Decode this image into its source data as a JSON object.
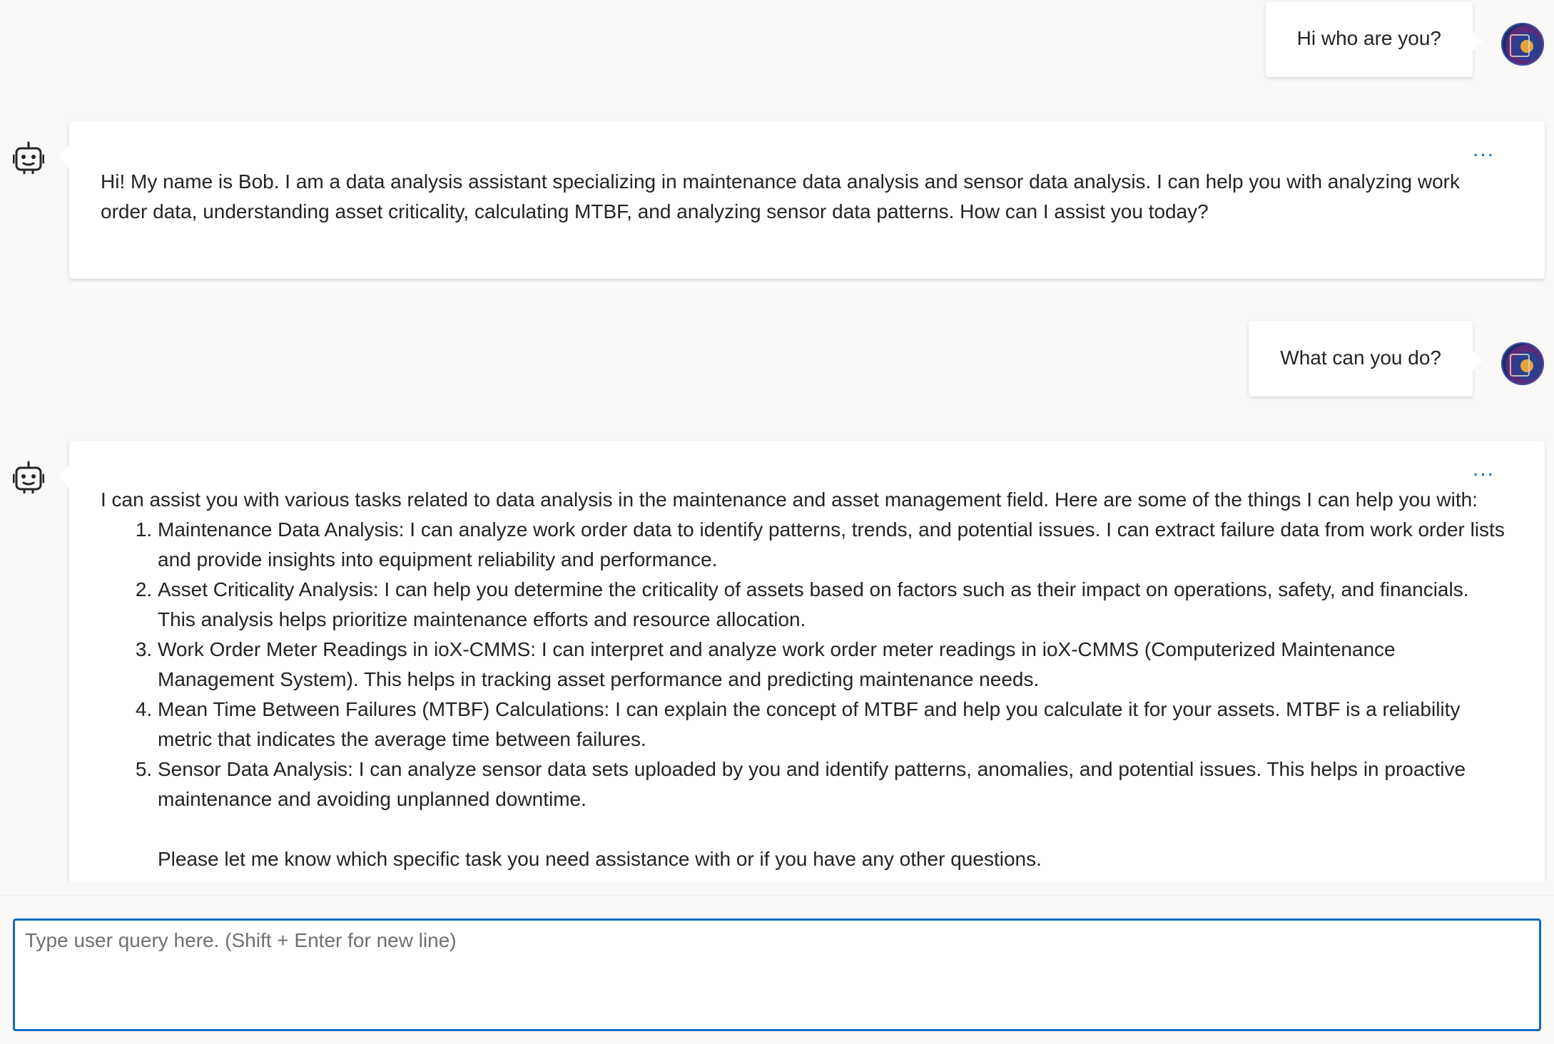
{
  "messages": {
    "user1": {
      "text": "Hi who are you?"
    },
    "bot1": {
      "more_label": "...",
      "text": "Hi! My name is Bob. I am a data analysis assistant specializing in maintenance data analysis and sensor data analysis. I can help you with analyzing work order data, understanding asset criticality, calculating MTBF, and analyzing sensor data patterns. How can I assist you today?"
    },
    "user2": {
      "text": "What can you do?"
    },
    "bot2": {
      "more_label": "...",
      "intro": "I can assist you with various tasks related to data analysis in the maintenance and asset management field. Here are some of the things I can help you with:",
      "items": [
        "Maintenance Data Analysis: I can analyze work order data to identify patterns, trends, and potential issues. I can extract failure data from work order lists and provide insights into equipment reliability and performance.",
        "Asset Criticality Analysis: I can help you determine the criticality of assets based on factors such as their impact on operations, safety, and financials. This analysis helps prioritize maintenance efforts and resource allocation.",
        "Work Order Meter Readings in ioX-CMMS: I can interpret and analyze work order meter readings in ioX-CMMS (Computerized Maintenance Management System). This helps in tracking asset performance and predicting maintenance needs.",
        "Mean Time Between Failures (MTBF) Calculations: I can explain the concept of MTBF and help you calculate it for your assets. MTBF is a reliability metric that indicates the average time between failures.",
        "Sensor Data Analysis: I can analyze sensor data sets uploaded by you and identify patterns, anomalies, and potential issues. This helps in proactive maintenance and avoiding unplanned downtime."
      ],
      "closing": "Please let me know which specific task you need assistance with or if you have any other questions."
    }
  },
  "composer": {
    "placeholder": "Type user query here. (Shift + Enter for new line)",
    "value": ""
  },
  "icons": {
    "bot": "bot-icon",
    "user_avatar": "avatar",
    "more": "more-icon"
  },
  "colors": {
    "accent": "#0f6cbd",
    "background": "#faf9f8",
    "bubble": "#ffffff",
    "text": "#242424"
  }
}
